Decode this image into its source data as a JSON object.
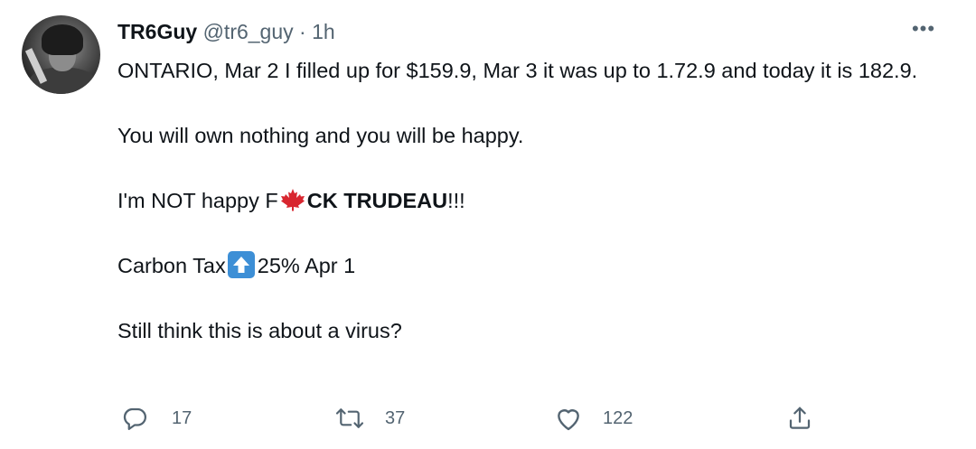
{
  "tweet": {
    "author": {
      "display_name": "TR6Guy",
      "handle": "@tr6_guy",
      "separator": "·",
      "time": "1h"
    },
    "more_label": "•••",
    "lines": {
      "line1": "ONTARIO, Mar 2 I filled up for $159.9, Mar 3 it was up to 1.72.9 and today it is 182.9.",
      "line2": "You will own nothing and you will be happy.",
      "line3_prefix": "I'm NOT happy F",
      "line3_bold": "CK TRUDEAU",
      "line3_suffix": "!!!",
      "line4_prefix": "Carbon Tax",
      "line4_suffix": "25% Apr 1",
      "line5": "Still think this is about a virus?"
    },
    "emoji": {
      "leaf": "maple-leaf-icon",
      "arrow": "up-arrow-icon"
    },
    "actions": {
      "reply_count": "17",
      "retweet_count": "37",
      "like_count": "122"
    },
    "colors": {
      "text": "#0f1419",
      "secondary": "#536471",
      "maple_red": "#d8262f",
      "arrow_blue": "#3d8fd6"
    }
  }
}
